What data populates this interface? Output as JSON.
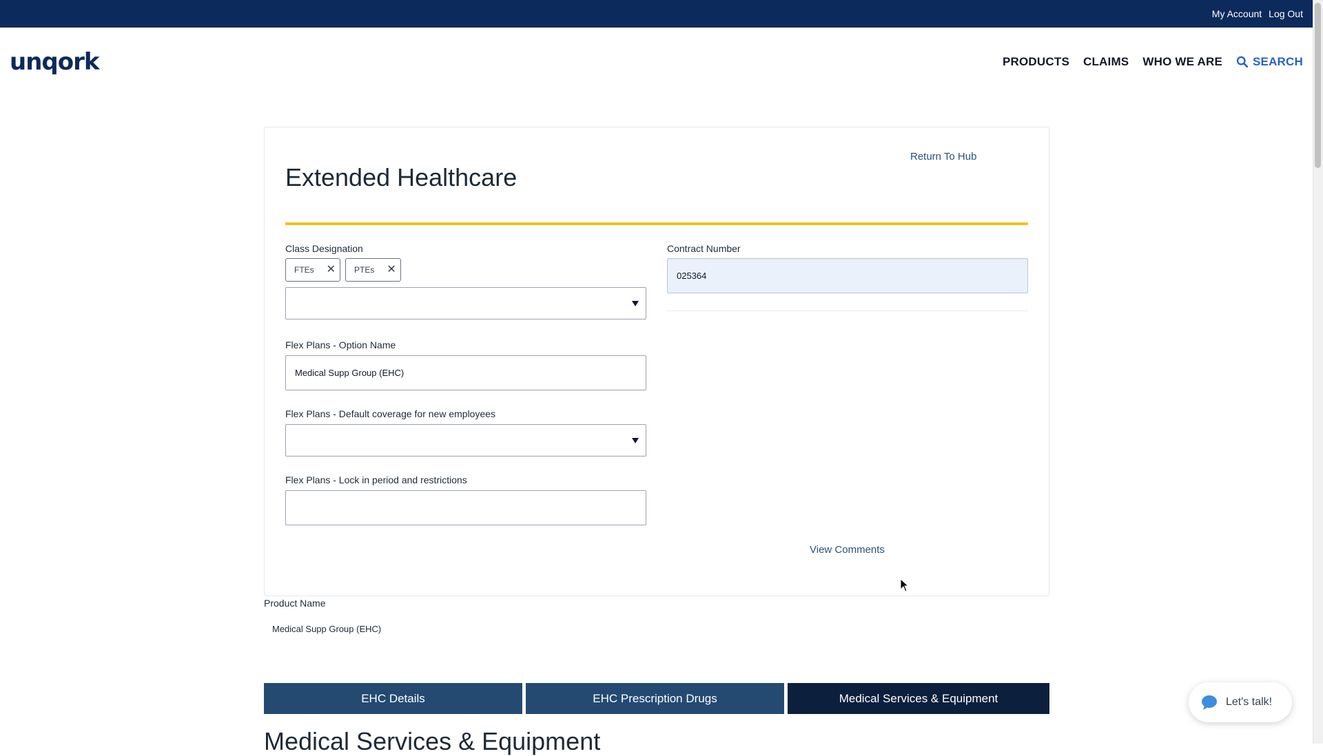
{
  "topbar": {
    "my_account": "My Account",
    "log_out": "Log Out"
  },
  "header": {
    "logo": "unqork",
    "nav": {
      "products": "PRODUCTS",
      "claims": "CLAIMS",
      "who_we_are": "WHO WE ARE",
      "search": "SEARCH"
    }
  },
  "card": {
    "return_link": "Return To Hub",
    "title": "Extended Healthcare",
    "class_designation": {
      "label": "Class Designation",
      "chips": [
        "FTEs",
        "PTEs"
      ],
      "remove_glyph": "✕"
    },
    "contract_number": {
      "label": "Contract Number",
      "value": "025364"
    },
    "flex_option_name": {
      "label": "Flex Plans - Option Name",
      "value": "Medical Supp Group (EHC)"
    },
    "flex_default_coverage": {
      "label": "Flex Plans - Default coverage for new employees"
    },
    "flex_lock_in": {
      "label": "Flex Plans - Lock in period and restrictions",
      "value": ""
    },
    "view_comments": "View Comments"
  },
  "product": {
    "label": "Product Name",
    "value": "Medical Supp Group (EHC)"
  },
  "tabs": [
    {
      "label": "EHC Details",
      "active": false
    },
    {
      "label": "EHC Prescription Drugs",
      "active": false
    },
    {
      "label": "Medical Services & Equipment",
      "active": true
    }
  ],
  "section_heading": "Medical Services & Equipment",
  "chat": {
    "label": "Let's talk!"
  },
  "colors": {
    "topbar": "#0c2a5b",
    "accent_gold": "#f2c21b",
    "tab": "#244a72",
    "tab_active": "#0c1f3d",
    "link": "#2b4f7e",
    "search": "#2563c9"
  }
}
